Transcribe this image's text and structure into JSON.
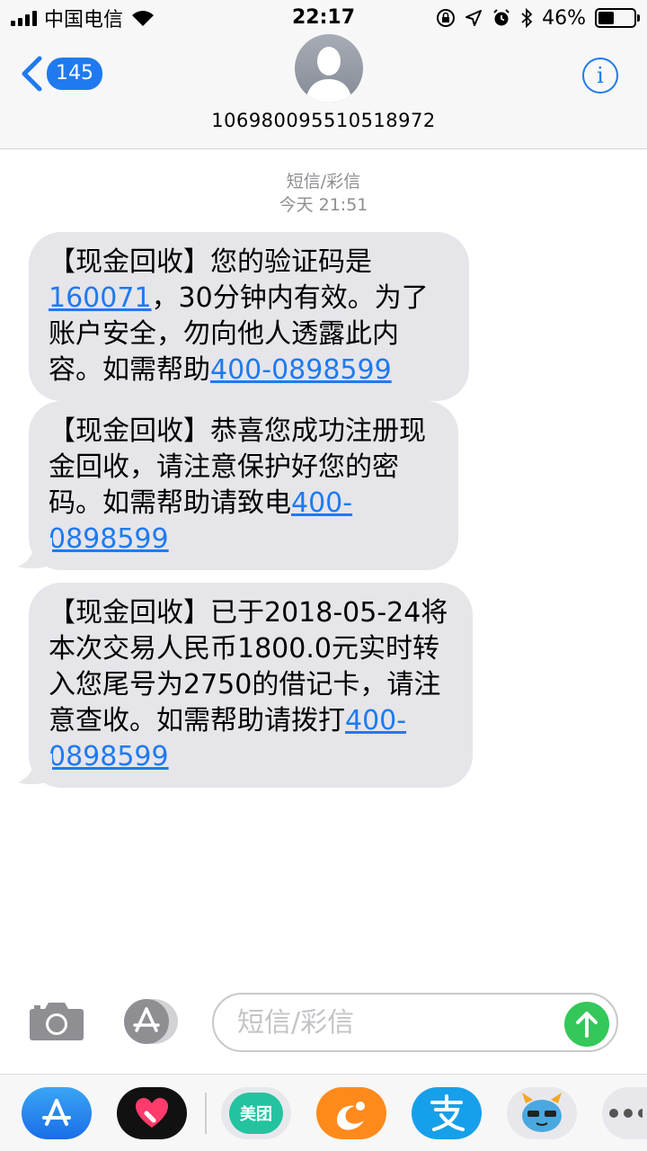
{
  "status_bar": {
    "carrier": "中国电信",
    "time": "22:17",
    "battery_percent": "46%",
    "battery_level": 0.46
  },
  "header": {
    "back_count": "145",
    "contact": "10698009551051897",
    "contact_suffix": "2",
    "info_label": "i"
  },
  "conversation": {
    "type_label": "短信/彩信",
    "timestamp": "今天 21:51",
    "messages": [
      {
        "p1": "【现金回收】您的验证码是",
        "link1": "160071",
        "p2": "，30分钟内有效。为了账户安全，勿向他人透露此内容。如需帮助",
        "link2": "400-0898599"
      },
      {
        "p1": "【现金回收】恭喜您成功注册现金回收，请注意保护好您的密码。如需帮助请致电",
        "link1": "400-0898599"
      },
      {
        "p1": "【现金回收】已于2018-05-24将本次交易人民币1800.0元实时转入您尾号为2750的借记卡，请注意查收。如需帮助请拨打",
        "link1": "400-0898599"
      }
    ]
  },
  "input": {
    "placeholder": "短信/彩信"
  },
  "app_drawer": {
    "apps": [
      {
        "icon": "app-store-icon"
      },
      {
        "icon": "digital-touch-icon"
      },
      {
        "icon": "meituan-icon",
        "label": "美团"
      },
      {
        "icon": "uc-browser-icon"
      },
      {
        "icon": "alipay-icon"
      },
      {
        "icon": "monster-sticker-icon"
      },
      {
        "icon": "more-icon"
      }
    ]
  }
}
